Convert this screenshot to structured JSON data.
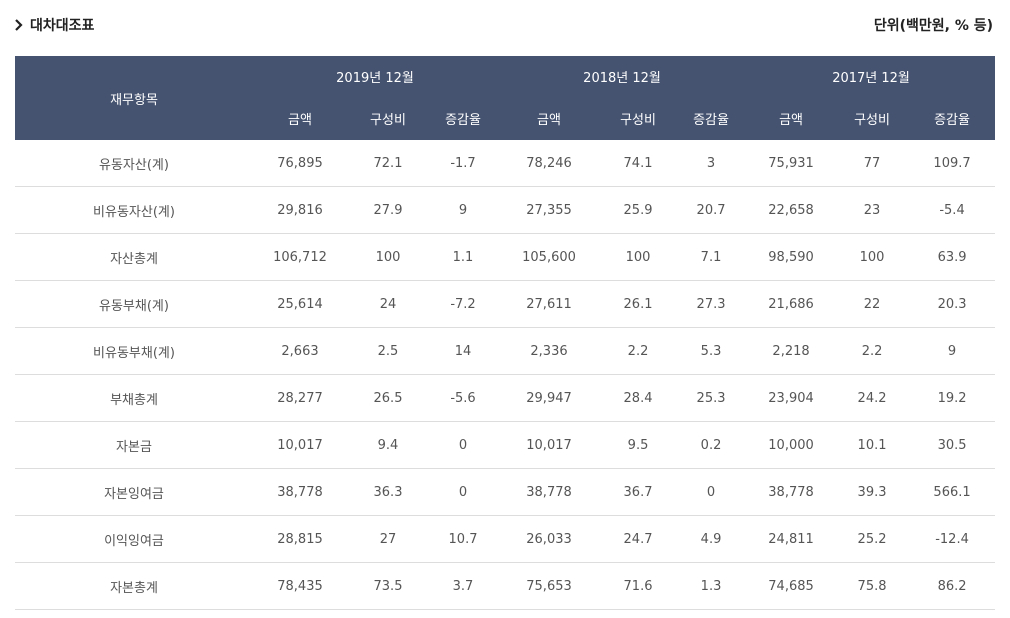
{
  "header": {
    "title": "대차대조표",
    "unit": "단위(백만원, % 등)"
  },
  "table": {
    "item_header": "재무항목",
    "years": [
      "2019년 12월",
      "2018년 12월",
      "2017년 12월"
    ],
    "subheaders": [
      "금액",
      "구성비",
      "증감율"
    ],
    "rows": [
      {
        "label": "유동자산(계)",
        "values": [
          "76,895",
          "72.1",
          "-1.7",
          "78,246",
          "74.1",
          "3",
          "75,931",
          "77",
          "109.7"
        ]
      },
      {
        "label": "비유동자산(계)",
        "values": [
          "29,816",
          "27.9",
          "9",
          "27,355",
          "25.9",
          "20.7",
          "22,658",
          "23",
          "-5.4"
        ]
      },
      {
        "label": "자산총계",
        "values": [
          "106,712",
          "100",
          "1.1",
          "105,600",
          "100",
          "7.1",
          "98,590",
          "100",
          "63.9"
        ]
      },
      {
        "label": "유동부채(계)",
        "values": [
          "25,614",
          "24",
          "-7.2",
          "27,611",
          "26.1",
          "27.3",
          "21,686",
          "22",
          "20.3"
        ]
      },
      {
        "label": "비유동부채(계)",
        "values": [
          "2,663",
          "2.5",
          "14",
          "2,336",
          "2.2",
          "5.3",
          "2,218",
          "2.2",
          "9"
        ]
      },
      {
        "label": "부채총계",
        "values": [
          "28,277",
          "26.5",
          "-5.6",
          "29,947",
          "28.4",
          "25.3",
          "23,904",
          "24.2",
          "19.2"
        ]
      },
      {
        "label": "자본금",
        "values": [
          "10,017",
          "9.4",
          "0",
          "10,017",
          "9.5",
          "0.2",
          "10,000",
          "10.1",
          "30.5"
        ]
      },
      {
        "label": "자본잉여금",
        "values": [
          "38,778",
          "36.3",
          "0",
          "38,778",
          "36.7",
          "0",
          "38,778",
          "39.3",
          "566.1"
        ]
      },
      {
        "label": "이익잉여금",
        "values": [
          "28,815",
          "27",
          "10.7",
          "26,033",
          "24.7",
          "4.9",
          "24,811",
          "25.2",
          "-12.4"
        ]
      },
      {
        "label": "자본총계",
        "values": [
          "78,435",
          "73.5",
          "3.7",
          "75,653",
          "71.6",
          "1.3",
          "74,685",
          "75.8",
          "86.2"
        ]
      }
    ]
  }
}
